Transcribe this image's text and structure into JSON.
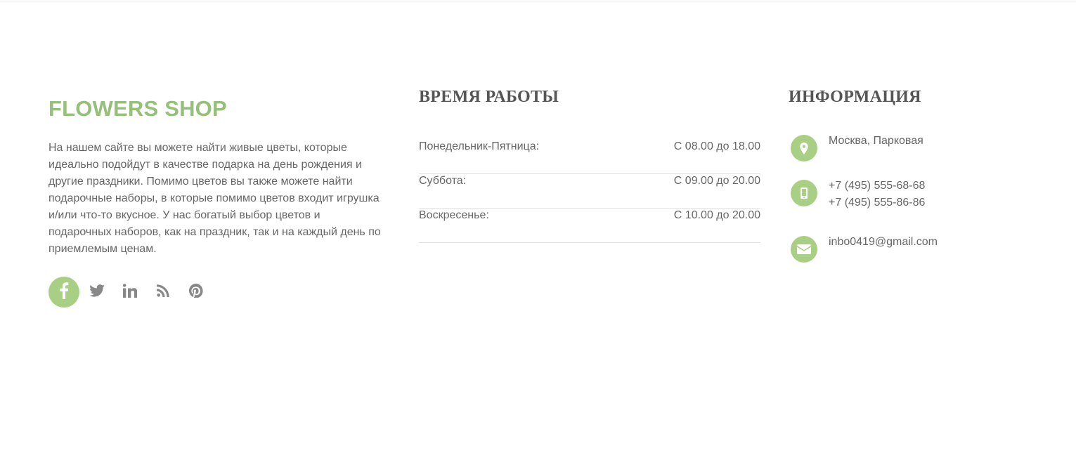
{
  "about": {
    "brand": "FLOWERS SHOP",
    "text": "На нашем сайте вы можете найти живые цветы, которые идеально подойдут в качестве подарка на день рождения и другие праздники. Помимо цветов вы также можете найти подарочные наборы, в которые помимо цветов входит игрушка и/или что-то вкусное. У нас богатый выбор цветов и подарочных наборов, как на праздник, так и на каждый день по приемлемым ценам."
  },
  "social": [
    {
      "icon": "facebook-icon",
      "active": true
    },
    {
      "icon": "twitter-icon",
      "active": false
    },
    {
      "icon": "linkedin-icon",
      "active": false
    },
    {
      "icon": "rss-icon",
      "active": false
    },
    {
      "icon": "pinterest-icon",
      "active": false
    }
  ],
  "hours": {
    "title": "ВРЕМЯ РАБОТЫ",
    "rows": [
      {
        "day": "Понедельник-Пятница:",
        "time": "С 08.00 до 18.00"
      },
      {
        "day": "Суббота:",
        "time": "С 09.00 до 20.00"
      },
      {
        "day": "Воскресенье:",
        "time": "С 10.00 до 20.00"
      }
    ]
  },
  "info": {
    "title": "ИНФОРМАЦИЯ",
    "address": "Москва, Парковая",
    "phone1": "+7 (495) 555-68-68",
    "phone2": "+7 (495) 555-86-86",
    "email": "inbo0419@gmail.com",
    "icons": [
      "map-marker-icon",
      "mobile-phone-icon",
      "envelope-icon"
    ]
  },
  "colors": {
    "accent": "#a8cf84",
    "brand": "#95c07a",
    "text": "#666666",
    "heading": "#555555",
    "divider": "#e2e2e2"
  }
}
